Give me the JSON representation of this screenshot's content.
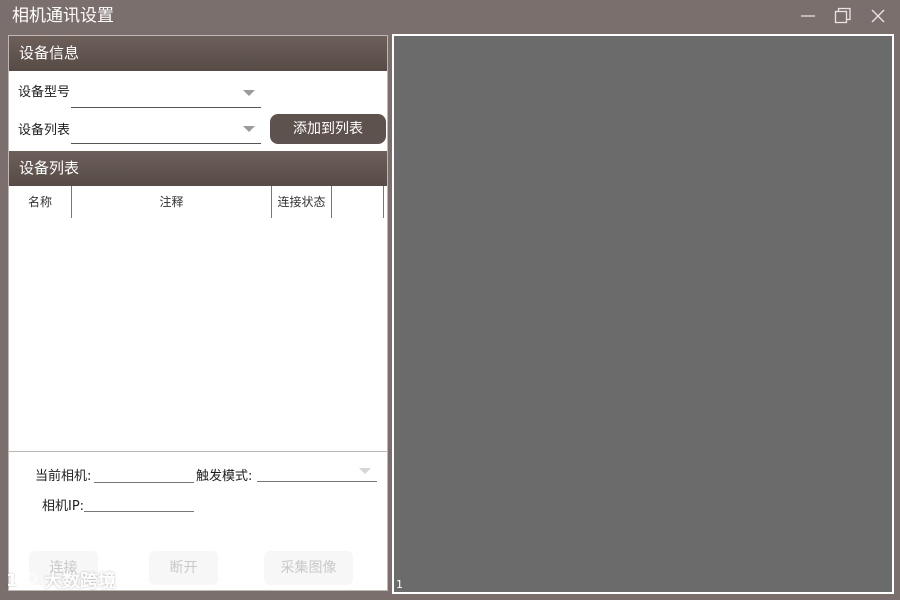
{
  "window": {
    "title": "相机通讯设置",
    "controls": {
      "minimize": "minimize-icon",
      "restore": "restore-icon",
      "close": "close-icon"
    }
  },
  "device_info": {
    "header": "设备信息",
    "model_label": "设备型号",
    "model_value": "",
    "list_label": "设备列表",
    "list_value": "",
    "add_button": "添加到列表"
  },
  "device_list": {
    "header": "设备列表",
    "columns": [
      "名称",
      "注释",
      "连接状态",
      ""
    ],
    "rows": []
  },
  "camera": {
    "current_label": "当前相机:",
    "current_value": "",
    "trigger_label": "触发模式:",
    "trigger_value": "",
    "ip_label": "相机IP:",
    "ip_value": ""
  },
  "actions": {
    "connect": "连接",
    "disconnect": "断开",
    "capture": "采集图像"
  },
  "viewer": {
    "index": "1"
  },
  "watermark": {
    "text": "大数跨境"
  },
  "colors": {
    "titlebar": "#7a6f6c",
    "section_header": "#5e524e",
    "viewer_bg": "#6b6b6b"
  }
}
